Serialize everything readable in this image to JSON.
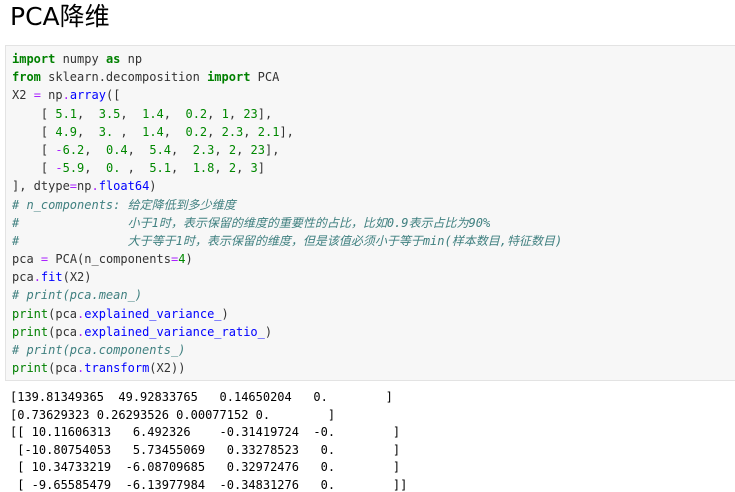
{
  "page": {
    "title": "PCA降维"
  },
  "code_lines": [
    [
      {
        "t": "import",
        "c": "kw"
      },
      {
        "t": " numpy ",
        "c": "text"
      },
      {
        "t": "as",
        "c": "kw"
      },
      {
        "t": " np",
        "c": "text"
      }
    ],
    [
      {
        "t": "from",
        "c": "kw"
      },
      {
        "t": " sklearn.decomposition ",
        "c": "text"
      },
      {
        "t": "import",
        "c": "kw"
      },
      {
        "t": " PCA",
        "c": "text"
      }
    ],
    [
      {
        "t": "X2 ",
        "c": "text"
      },
      {
        "t": "=",
        "c": "op"
      },
      {
        "t": " np",
        "c": "text"
      },
      {
        "t": ".",
        "c": "op"
      },
      {
        "t": "array",
        "c": "attr"
      },
      {
        "t": "([",
        "c": "text"
      }
    ],
    [
      {
        "t": "    [ ",
        "c": "text"
      },
      {
        "t": "5.1",
        "c": "num"
      },
      {
        "t": ",  ",
        "c": "text"
      },
      {
        "t": "3.5",
        "c": "num"
      },
      {
        "t": ",  ",
        "c": "text"
      },
      {
        "t": "1.4",
        "c": "num"
      },
      {
        "t": ",  ",
        "c": "text"
      },
      {
        "t": "0.2",
        "c": "num"
      },
      {
        "t": ", ",
        "c": "text"
      },
      {
        "t": "1",
        "c": "num"
      },
      {
        "t": ", ",
        "c": "text"
      },
      {
        "t": "23",
        "c": "num"
      },
      {
        "t": "],",
        "c": "text"
      }
    ],
    [
      {
        "t": "    [ ",
        "c": "text"
      },
      {
        "t": "4.9",
        "c": "num"
      },
      {
        "t": ",  ",
        "c": "text"
      },
      {
        "t": "3.",
        "c": "num"
      },
      {
        "t": " ,  ",
        "c": "text"
      },
      {
        "t": "1.4",
        "c": "num"
      },
      {
        "t": ",  ",
        "c": "text"
      },
      {
        "t": "0.2",
        "c": "num"
      },
      {
        "t": ", ",
        "c": "text"
      },
      {
        "t": "2.3",
        "c": "num"
      },
      {
        "t": ", ",
        "c": "text"
      },
      {
        "t": "2.1",
        "c": "num"
      },
      {
        "t": "],",
        "c": "text"
      }
    ],
    [
      {
        "t": "    [ ",
        "c": "text"
      },
      {
        "t": "-",
        "c": "op"
      },
      {
        "t": "6.2",
        "c": "num"
      },
      {
        "t": ",  ",
        "c": "text"
      },
      {
        "t": "0.4",
        "c": "num"
      },
      {
        "t": ",  ",
        "c": "text"
      },
      {
        "t": "5.4",
        "c": "num"
      },
      {
        "t": ",  ",
        "c": "text"
      },
      {
        "t": "2.3",
        "c": "num"
      },
      {
        "t": ", ",
        "c": "text"
      },
      {
        "t": "2",
        "c": "num"
      },
      {
        "t": ", ",
        "c": "text"
      },
      {
        "t": "23",
        "c": "num"
      },
      {
        "t": "],",
        "c": "text"
      }
    ],
    [
      {
        "t": "    [ ",
        "c": "text"
      },
      {
        "t": "-",
        "c": "op"
      },
      {
        "t": "5.9",
        "c": "num"
      },
      {
        "t": ",  ",
        "c": "text"
      },
      {
        "t": "0.",
        "c": "num"
      },
      {
        "t": " ,  ",
        "c": "text"
      },
      {
        "t": "5.1",
        "c": "num"
      },
      {
        "t": ",  ",
        "c": "text"
      },
      {
        "t": "1.8",
        "c": "num"
      },
      {
        "t": ", ",
        "c": "text"
      },
      {
        "t": "2",
        "c": "num"
      },
      {
        "t": ", ",
        "c": "text"
      },
      {
        "t": "3",
        "c": "num"
      },
      {
        "t": "]",
        "c": "text"
      }
    ],
    [
      {
        "t": "], dtype",
        "c": "text"
      },
      {
        "t": "=",
        "c": "op"
      },
      {
        "t": "np",
        "c": "text"
      },
      {
        "t": ".",
        "c": "op"
      },
      {
        "t": "float64",
        "c": "attr"
      },
      {
        "t": ")",
        "c": "text"
      }
    ],
    [
      {
        "t": "# n_components: 给定降低到多少维度",
        "c": "comment"
      }
    ],
    [
      {
        "t": "#               小于1时，表示保留的维度的重要性的占比，比如0.9表示占比为90%",
        "c": "comment"
      }
    ],
    [
      {
        "t": "#               大于等于1时，表示保留的维度，但是该值必须小于等于min(样本数目,特征数目)",
        "c": "comment"
      }
    ],
    [
      {
        "t": "pca ",
        "c": "text"
      },
      {
        "t": "=",
        "c": "op"
      },
      {
        "t": " PCA(n_components",
        "c": "text"
      },
      {
        "t": "=",
        "c": "op"
      },
      {
        "t": "4",
        "c": "num"
      },
      {
        "t": ")",
        "c": "text"
      }
    ],
    [
      {
        "t": "pca",
        "c": "text"
      },
      {
        "t": ".",
        "c": "op"
      },
      {
        "t": "fit",
        "c": "attr"
      },
      {
        "t": "(X2)",
        "c": "text"
      }
    ],
    [
      {
        "t": "# print(pca.mean_)",
        "c": "comment"
      }
    ],
    [
      {
        "t": "print",
        "c": "fn"
      },
      {
        "t": "(pca",
        "c": "text"
      },
      {
        "t": ".",
        "c": "op"
      },
      {
        "t": "explained_variance_",
        "c": "attr"
      },
      {
        "t": ")",
        "c": "text"
      }
    ],
    [
      {
        "t": "print",
        "c": "fn"
      },
      {
        "t": "(pca",
        "c": "text"
      },
      {
        "t": ".",
        "c": "op"
      },
      {
        "t": "explained_variance_ratio_",
        "c": "attr"
      },
      {
        "t": ")",
        "c": "text"
      }
    ],
    [
      {
        "t": "# print(pca.components_)",
        "c": "comment"
      }
    ],
    [
      {
        "t": "print",
        "c": "fn"
      },
      {
        "t": "(pca",
        "c": "text"
      },
      {
        "t": ".",
        "c": "op"
      },
      {
        "t": "transform",
        "c": "attr"
      },
      {
        "t": "(X2))",
        "c": "text"
      }
    ]
  ],
  "output_lines": [
    "[139.81349365  49.92833765   0.14650204   0.        ]",
    "[0.73629323 0.26293526 0.00077152 0.        ]",
    "[[ 10.11606313   6.492326    -0.31419724  -0.        ]",
    " [-10.80754053   5.73455069   0.33278523   0.        ]",
    " [ 10.34733219  -6.08709685   0.32972476   0.        ]",
    " [ -9.65585479  -6.13977984  -0.34831276   0.        ]]"
  ]
}
